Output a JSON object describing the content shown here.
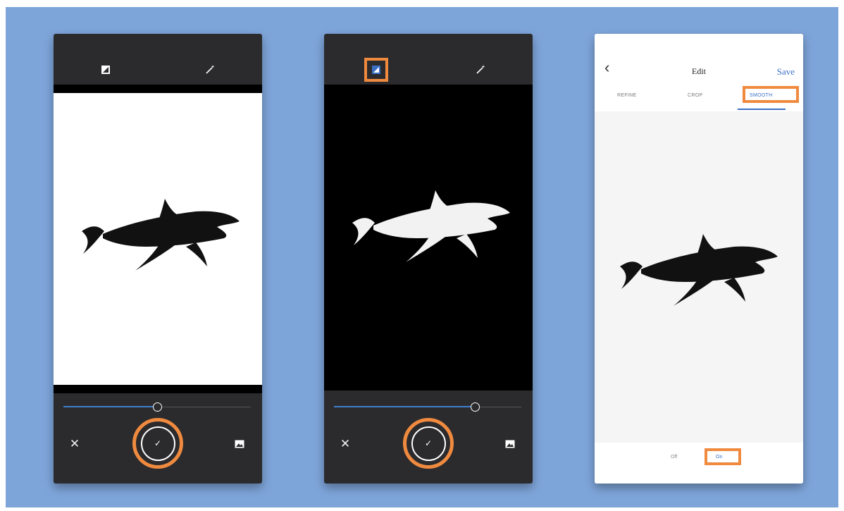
{
  "panels": [
    {
      "id": "panel-1",
      "top_icons": [
        "crop-image-icon",
        "magic-wand-icon"
      ],
      "slider_value_fraction": 0.5,
      "bottom_icons": [
        "close-icon",
        "confirm-check-icon",
        "image-icon"
      ],
      "highlighted": [
        "confirm-button"
      ]
    },
    {
      "id": "panel-2",
      "top_icons": [
        "invert-image-icon",
        "magic-wand-icon"
      ],
      "slider_value_fraction": 0.75,
      "bottom_icons": [
        "close-icon",
        "confirm-check-icon",
        "image-icon"
      ],
      "highlighted": [
        "invert-button",
        "confirm-button"
      ]
    },
    {
      "id": "panel-3",
      "header": {
        "back_icon": "chevron-left-icon",
        "title": "Edit",
        "save_label": "Save"
      },
      "tabs": [
        {
          "label": "REFINE",
          "active": false
        },
        {
          "label": "CROP",
          "active": false
        },
        {
          "label": "SMOOTH",
          "active": true
        }
      ],
      "smooth_options": [
        {
          "label": "Off",
          "selected": false
        },
        {
          "label": "On",
          "selected": true
        }
      ],
      "highlighted": [
        "tab-smooth",
        "on-option"
      ]
    }
  ],
  "colors": {
    "background": "#7ea5da",
    "highlight": "#ef8a3f",
    "accent": "#3b6fc4",
    "dark_ui": "#2b2b2d"
  }
}
